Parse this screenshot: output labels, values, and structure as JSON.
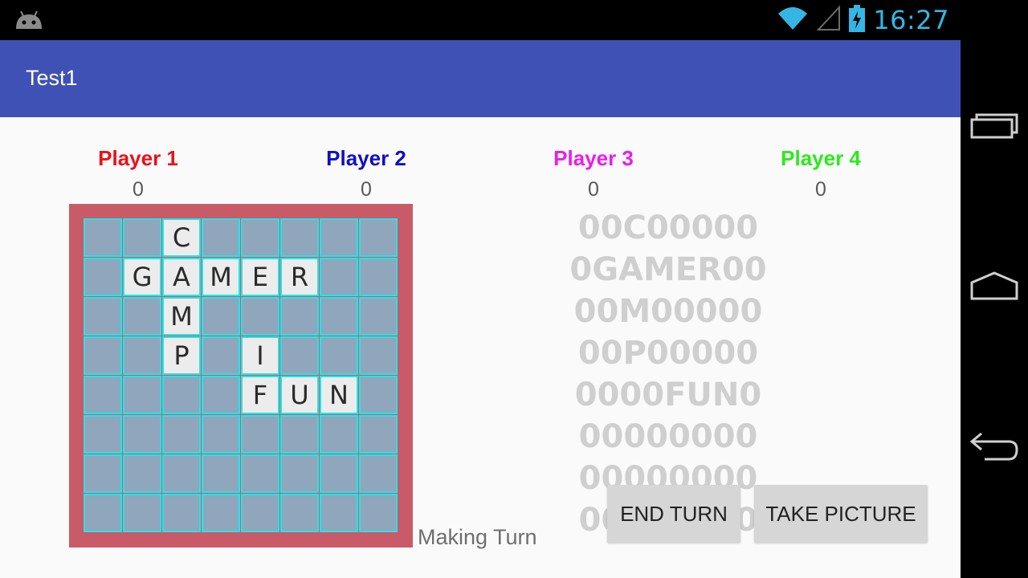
{
  "status_bar": {
    "time": "16:27"
  },
  "app_bar": {
    "title": "Test1"
  },
  "players": [
    {
      "name": "Player 1",
      "score": "0",
      "color": "#e8121a"
    },
    {
      "name": "Player 2",
      "score": "0",
      "color": "#1010c0"
    },
    {
      "name": "Player 3",
      "score": "0",
      "color": "#e81ee8"
    },
    {
      "name": "Player 4",
      "score": "0",
      "color": "#2ee81e"
    }
  ],
  "board": {
    "rows": [
      [
        "",
        "",
        "C",
        "",
        "",
        "",
        "",
        ""
      ],
      [
        "",
        "G",
        "A",
        "M",
        "E",
        "R",
        "",
        ""
      ],
      [
        "",
        "",
        "M",
        "",
        "",
        "",
        "",
        ""
      ],
      [
        "",
        "",
        "P",
        "",
        "I",
        "",
        "",
        ""
      ],
      [
        "",
        "",
        "",
        "",
        "F",
        "U",
        "N",
        ""
      ],
      [
        "",
        "",
        "",
        "",
        "",
        "",
        "",
        ""
      ],
      [
        "",
        "",
        "",
        "",
        "",
        "",
        "",
        ""
      ],
      [
        "",
        "",
        "",
        "",
        "",
        "",
        "",
        ""
      ]
    ],
    "grid_color": "#24e5e8",
    "tile_color": "#ececec",
    "empty_color": "#8fa6bd",
    "frame_color": "#c95a68"
  },
  "status_label": "Making Turn",
  "text_rows": [
    "00C00000",
    "0GAMER00",
    "00M00000",
    "00P00000",
    "0000FUN0",
    "00000000",
    "00000000",
    "00000000"
  ],
  "buttons": {
    "end_turn": "END TURN",
    "take_picture": "TAKE PICTURE"
  },
  "icons": {
    "android": "android-icon",
    "wifi": "wifi-icon",
    "signal": "signal-icon",
    "battery": "battery-charging-icon",
    "recents": "recents-icon",
    "home": "home-icon",
    "back": "back-icon"
  }
}
